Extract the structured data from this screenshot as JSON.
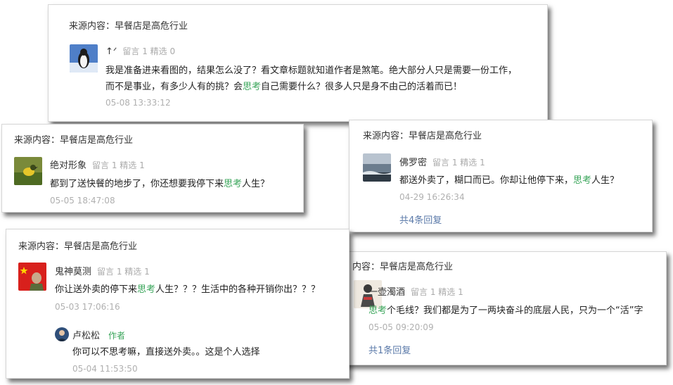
{
  "colors": {
    "highlight": "#39a55a",
    "link": "#5b7aa9",
    "muted": "#b0b0b0"
  },
  "source_prefix": "来源内容：",
  "source_title": "早餐店是高危行业",
  "cards": [
    {
      "source_label": "来源内容：早餐店是高危行业",
      "user": "↑ᐟ",
      "stats": "留言 1 精选 0",
      "text_line1": "我是准备进来看图的，结果怎么没了？看文章标题就知道作者是煞笔。绝大部分人只是需要一份工作，",
      "text_line2_pre": "而不是事业，有多少人有的挑？会",
      "keyword": "思考",
      "text_line2_post": "自己需要什么？很多人只是身不由己的活着而已！",
      "time": "05-08 13:33:12",
      "avatar_icon": "penguin-icon"
    },
    {
      "source_label": "来源内容：早餐店是高危行业",
      "user": "绝对形象",
      "stats": "留言 1 精选 1",
      "text_pre": "都到了送快餐的地步了，你还想要我停下来",
      "keyword": "思考",
      "text_post": "人生？",
      "time": "05-05 18:47:08",
      "avatar_icon": "bird-icon"
    },
    {
      "source_label": "来源内容：早餐店是高危行业",
      "user": "佛罗密",
      "stats": "留言 1 精选 1",
      "text_pre": "都送外卖了，糊口而已。你却让他停下来，",
      "keyword": "思考",
      "text_post": "人生？",
      "time": "04-29 16:26:34",
      "replies": "共4条回复",
      "avatar_icon": "seascape-icon"
    },
    {
      "source_label": "来源内容：早餐店是高危行业",
      "user": "鬼神莫测",
      "stats": "留言 1 精选 1",
      "text_pre": "你让送外卖的停下来",
      "keyword": "思考",
      "text_post": "人生？？？生活中的各种开销你出？？？",
      "time": "05-03 17:06:16",
      "reply": {
        "user": "卢松松",
        "tag": "作者",
        "text": "你可以不思考嘛，直接送外卖。。这是个人选择",
        "time": "05-04 11:53:50"
      },
      "avatar_icon": "flag-icon"
    },
    {
      "source_label": "内容：早餐店是高危行业",
      "user": "一壶濁酒",
      "stats": "留言 1 精选 1",
      "keyword": "思考",
      "text_post": "个毛线？我们都是为了一两块奋斗的底层人民，只为一个“活”字",
      "time": "05-05 09:20:09",
      "replies": "共1条回复",
      "avatar_icon": "figure-icon"
    }
  ]
}
